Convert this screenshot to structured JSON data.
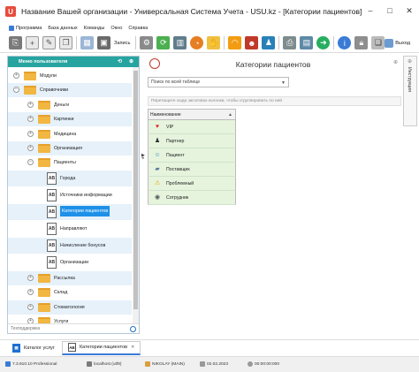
{
  "window": {
    "title": "Название Вашей организации - Универсальная Система Учета - USU.kz - [Категории пациентов]",
    "minimize": "–",
    "maximize": "□",
    "close": "✕"
  },
  "menu": [
    "Программа",
    "База данных",
    "Команды",
    "Окно",
    "Справка"
  ],
  "toolbar": {
    "save_label": "Запись",
    "exit_label": "Выход"
  },
  "sidebar": {
    "title": "Меню пользователя",
    "search_placeholder": "Техподдержка",
    "items": [
      {
        "label": "Модули",
        "type": "folder",
        "exp": "+"
      },
      {
        "label": "Справочники",
        "type": "folder",
        "exp": "−"
      },
      {
        "label": "Деньги",
        "type": "folder",
        "exp": "+"
      },
      {
        "label": "Картинки",
        "type": "folder",
        "exp": "+"
      },
      {
        "label": "Медицина",
        "type": "folder",
        "exp": "+"
      },
      {
        "label": "Организация",
        "type": "folder",
        "exp": "+"
      },
      {
        "label": "Пациенты",
        "type": "folder",
        "exp": "−"
      },
      {
        "label": "Города",
        "type": "doc"
      },
      {
        "label": "Источники информации",
        "type": "doc"
      },
      {
        "label": "Категории пациентов",
        "type": "doc",
        "selected": true
      },
      {
        "label": "Направляют",
        "type": "doc"
      },
      {
        "label": "Начисление бонусов",
        "type": "doc"
      },
      {
        "label": "Организации",
        "type": "doc"
      },
      {
        "label": "Рассылка",
        "type": "folder",
        "exp": "+"
      },
      {
        "label": "Склад",
        "type": "folder",
        "exp": "+"
      },
      {
        "label": "Стоматология",
        "type": "folder",
        "exp": "+"
      },
      {
        "label": "Услуги",
        "type": "folder",
        "exp": "+"
      }
    ]
  },
  "content": {
    "title": "Категории пациентов",
    "search_label": "Поиск по всей таблице",
    "group_hint": "Перетащите сюда заголовок колонки, чтобы сгруппировать по ней",
    "column_header": "Наименование",
    "rows": [
      {
        "label": "VIP",
        "icon": "heart-icon",
        "glyph": "♥",
        "color": "#d9302c"
      },
      {
        "label": "Партнер",
        "icon": "person-icon",
        "glyph": "♟",
        "color": "#333333"
      },
      {
        "label": "Пациент",
        "icon": "patient-icon",
        "glyph": "☺",
        "color": "#2c7bc8"
      },
      {
        "label": "Поставщик",
        "icon": "truck-icon",
        "glyph": "▰",
        "color": "#5c7da0"
      },
      {
        "label": "Проблемный",
        "icon": "warning-icon",
        "glyph": "⚠",
        "color": "#e0a800"
      },
      {
        "label": "Сотрудник",
        "icon": "employee-icon",
        "glyph": "◉",
        "color": "#555555"
      }
    ]
  },
  "right_rail": {
    "label": "Инструкция"
  },
  "tabs": [
    {
      "label": "Каталог услуг",
      "active": false
    },
    {
      "label": "Категории пациентов",
      "active": true
    }
  ],
  "status": {
    "version": "7.3.910.10 Professional",
    "db": "localhost (utf8)",
    "user": "NIKOLAY (MAIN)",
    "date": "02.02.2023",
    "time": "00:00:00:000"
  },
  "colors": {
    "sidebar_header": "#27a4a0",
    "selection": "#1e90e8",
    "grid_row": "#e6f4dd"
  }
}
